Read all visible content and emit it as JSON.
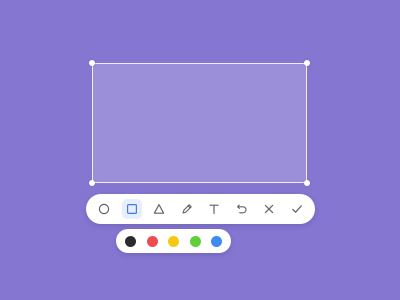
{
  "selection": {
    "handles": [
      "top-left",
      "top-right",
      "bottom-left",
      "bottom-right"
    ]
  },
  "toolbar": {
    "active_tool": "rectangle",
    "icon_color": "#5f6368",
    "active_color": "#3d7cf0",
    "tools": [
      {
        "name": "circle-tool",
        "icon": "circle-icon"
      },
      {
        "name": "rectangle-tool",
        "icon": "square-icon",
        "active": true
      },
      {
        "name": "triangle-tool",
        "icon": "triangle-icon"
      },
      {
        "name": "pen-tool",
        "icon": "pen-icon"
      },
      {
        "name": "text-tool",
        "icon": "text-icon"
      },
      {
        "name": "undo-button",
        "icon": "undo-icon"
      },
      {
        "name": "cancel-button",
        "icon": "close-icon"
      },
      {
        "name": "confirm-button",
        "icon": "check-icon"
      }
    ]
  },
  "palette": {
    "colors": [
      "#2b2b2b",
      "#f04b55",
      "#f5c814",
      "#5fcf3c",
      "#3a8cf0"
    ],
    "selected": "#2b2b2b"
  }
}
